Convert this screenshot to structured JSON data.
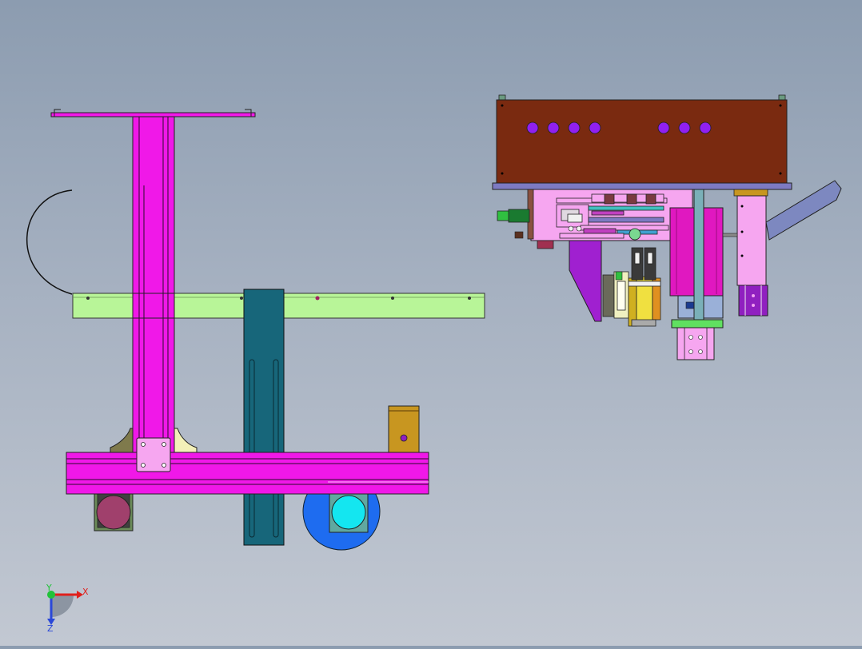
{
  "viewport": {
    "background_top": "#8c9cb0",
    "background_bottom": "#c2c8d2"
  },
  "triad": {
    "x_label": "X",
    "y_label": "Y",
    "z_label": "Z",
    "x_color": "#e0201c",
    "y_color": "#22c23a",
    "z_color": "#2a48d8"
  },
  "colors": {
    "frame_magenta": "#f018e8",
    "rail_green": "#b8f598",
    "teal_bracket": "#17667a",
    "motor_blue": "#1e6cf0",
    "motor_cyan": "#14e6f0",
    "motor_brown": "#a0406c",
    "top_plate_brown": "#7a2a10",
    "hole_purple": "#9020f0",
    "light_pink": "#f6a6f0",
    "purple_bracket": "#a020d0",
    "gold_block": "#c89620"
  }
}
